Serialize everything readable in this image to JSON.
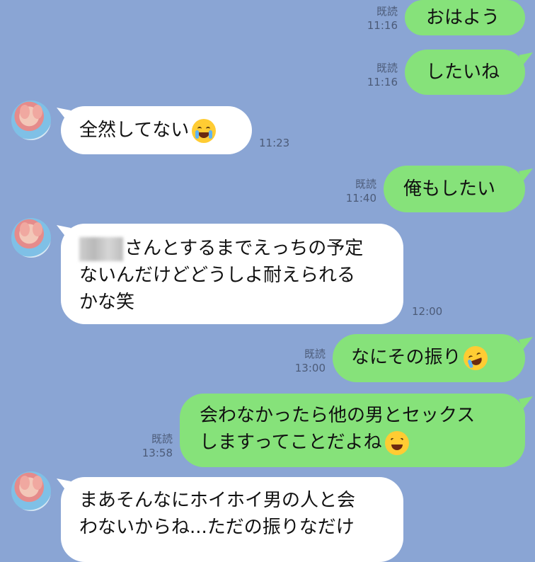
{
  "messages": [
    {
      "id": "m1",
      "side": "out",
      "text": "おはよう",
      "read": "既読",
      "time": "11:16"
    },
    {
      "id": "m2",
      "side": "out",
      "text": "したいね",
      "read": "既読",
      "time": "11:16"
    },
    {
      "id": "m3",
      "side": "in",
      "text": "全然してない",
      "emoji": "loudly-crying-face",
      "time": "11:23"
    },
    {
      "id": "m4",
      "side": "out",
      "text": "俺もしたい",
      "read": "既読",
      "time": "11:40"
    },
    {
      "id": "m5",
      "side": "in",
      "lines": [
        "さんとするまでえっちの予定",
        "ないんだけどどうしよ耐えられる",
        "かな笑"
      ],
      "time": "12:00"
    },
    {
      "id": "m6",
      "side": "out",
      "text": "なにその振り",
      "emoji": "rolling-laughing-face",
      "read": "既読",
      "time": "13:00"
    },
    {
      "id": "m7",
      "side": "out",
      "lines": [
        "会わなかったら他の男とセックス",
        "しますってことだよね"
      ],
      "emoji": "grinning-squinting-face",
      "read": "既読",
      "time": "13:58"
    },
    {
      "id": "m8",
      "side": "in",
      "lines": [
        "まあそんなにホイホイ男の人と会",
        "わないからね...ただの振りなだけ"
      ]
    }
  ],
  "colors": {
    "background": "#8aa5d4",
    "outgoing": "#86e27a",
    "incoming": "#ffffff"
  }
}
